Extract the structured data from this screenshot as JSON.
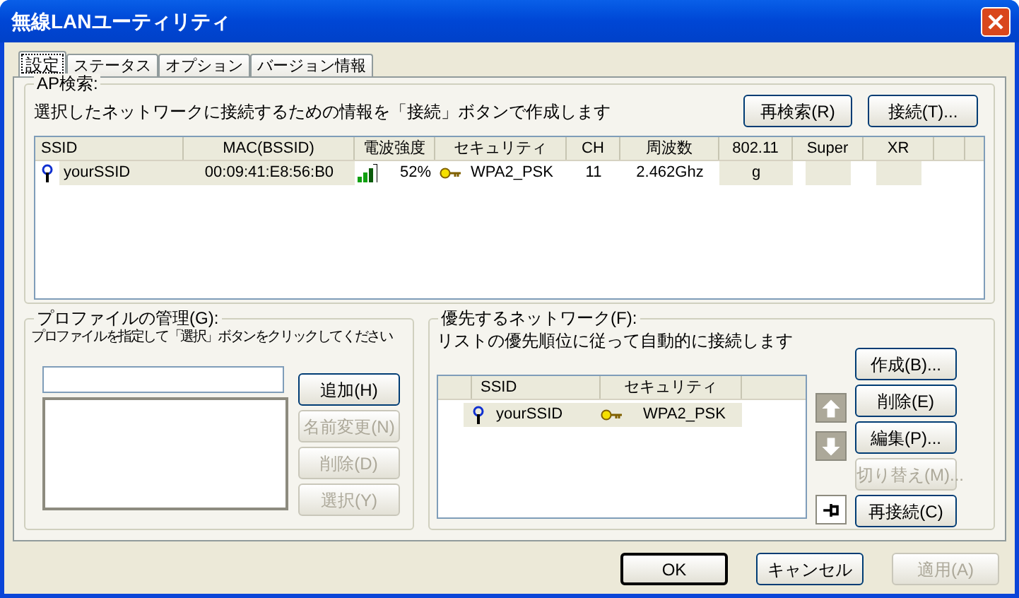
{
  "window": {
    "title": "無線LANユーティリティ"
  },
  "tabs": [
    {
      "label": "設定",
      "selected": true
    },
    {
      "label": "ステータス",
      "selected": false
    },
    {
      "label": "オプション",
      "selected": false
    },
    {
      "label": "バージョン情報",
      "selected": false
    }
  ],
  "ap_search": {
    "legend": "AP検索:",
    "description": "選択したネットワークに接続するための情報を「接続」ボタンで作成します",
    "buttons": [
      {
        "label": "再検索(R)",
        "disabled": false
      },
      {
        "label": "接続(T)...",
        "disabled": false
      }
    ],
    "columns": [
      "SSID",
      "MAC(BSSID)",
      "電波強度",
      "セキュリティ",
      "CH",
      "周波数",
      "802.11",
      "Super",
      "XR"
    ],
    "rows": [
      {
        "ssid": "yourSSID",
        "mac": "00:09:41:E8:56:B0",
        "signal": "52%",
        "security": "WPA2_PSK",
        "ch": "11",
        "frequency": "2.462Ghz",
        "mode": "g"
      }
    ]
  },
  "profiles": {
    "legend": "プロファイルの管理(G):",
    "description": "プロファイルを指定して「選択」ボタンをクリックしてください",
    "buttons": [
      {
        "label": "追加(H)",
        "disabled": false
      },
      {
        "label": "名前変更(N)",
        "disabled": true
      },
      {
        "label": "削除(D)",
        "disabled": true
      },
      {
        "label": "選択(Y)",
        "disabled": true
      }
    ]
  },
  "preferred": {
    "legend": "優先するネットワーク(F):",
    "description": "リストの優先順位に従って自動的に接続します",
    "columns": [
      "SSID",
      "セキュリティ"
    ],
    "rows": [
      {
        "ssid": "yourSSID",
        "security": "WPA2_PSK"
      }
    ],
    "icon_buttons": [
      {
        "kind": "up",
        "disabled": true
      },
      {
        "kind": "down",
        "disabled": true
      },
      {
        "kind": "pin",
        "disabled": false
      }
    ],
    "buttons": [
      {
        "label": "作成(B)...",
        "disabled": false
      },
      {
        "label": "削除(E)",
        "disabled": false
      },
      {
        "label": "編集(P)...",
        "disabled": false
      },
      {
        "label": "切り替え(M)...",
        "disabled": true
      },
      {
        "label": "再接続(C)",
        "disabled": false
      }
    ]
  },
  "footer_buttons": [
    {
      "label": "OK",
      "disabled": false,
      "default": true
    },
    {
      "label": "キャンセル",
      "disabled": false,
      "default": false
    },
    {
      "label": "適用(A)",
      "disabled": true,
      "default": false
    }
  ]
}
